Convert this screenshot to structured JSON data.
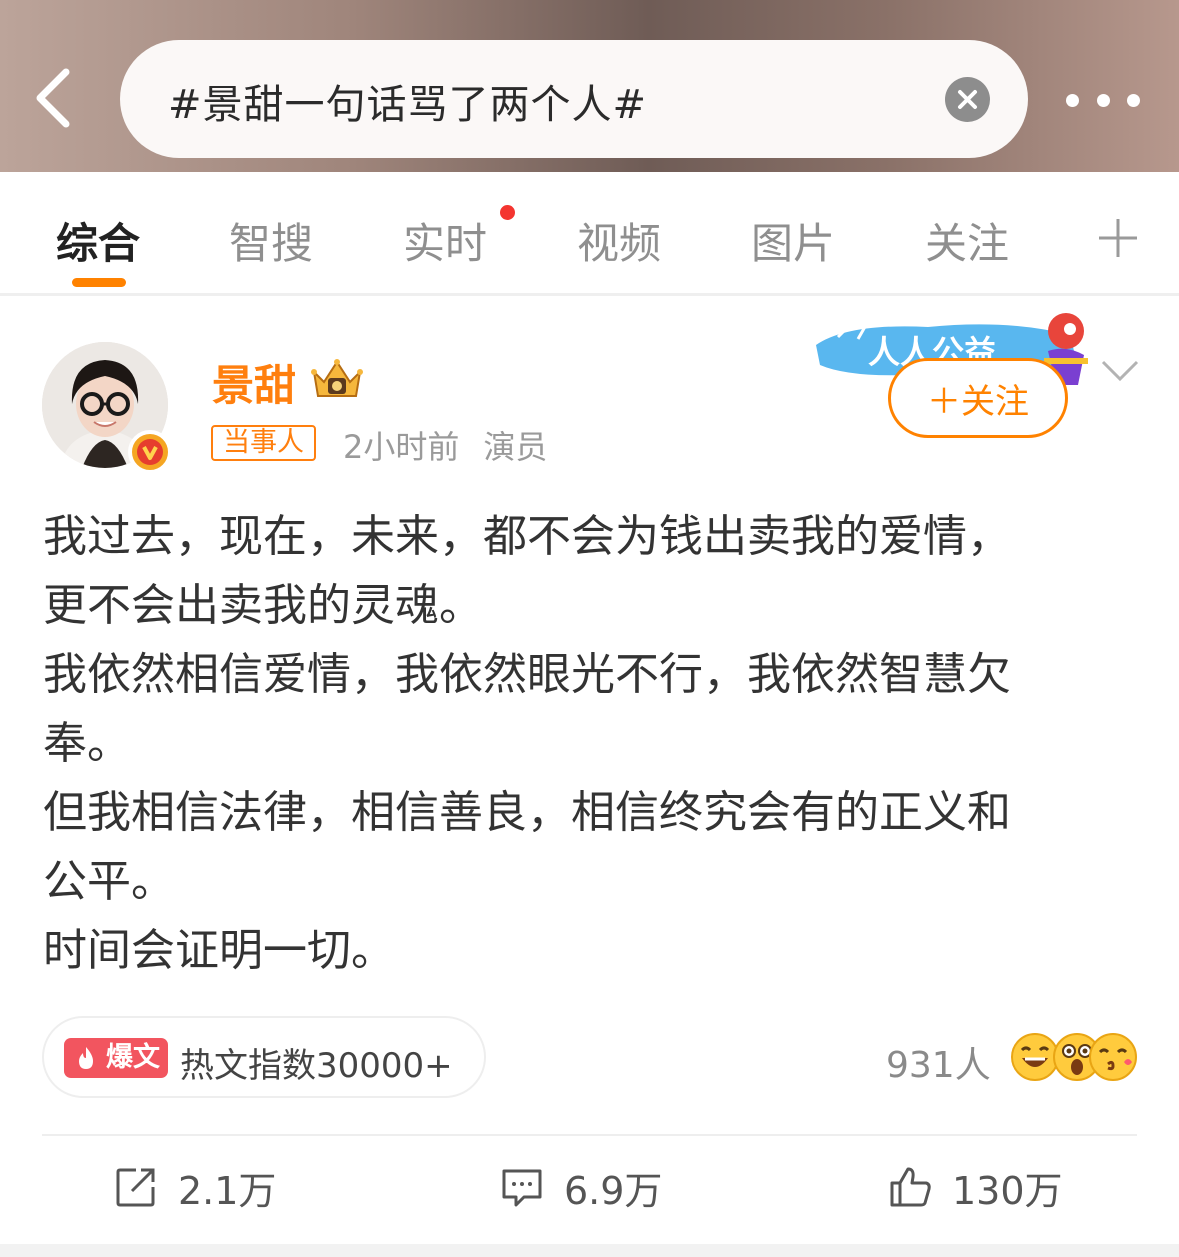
{
  "header": {
    "search_query": "#景甜一句话骂了两个人#",
    "back_icon": "chevron-left-icon",
    "clear_icon": "close-circle-icon",
    "more_icon": "more-dots-icon"
  },
  "tabs": [
    {
      "label": "综合",
      "active": true
    },
    {
      "label": "智搜"
    },
    {
      "label": "实时",
      "dot": true
    },
    {
      "label": "视频"
    },
    {
      "label": "图片"
    },
    {
      "label": "关注"
    }
  ],
  "post": {
    "username": "景甜",
    "role_tag": "当事人",
    "time": "2小时前",
    "identity": "演员",
    "banner_text": "人人公益",
    "follow_label": "＋关注",
    "body_lines": [
      "我过去，现在，未来，都不会为钱出卖我的爱情，",
      "更不会出卖我的灵魂。",
      "我依然相信爱情，我依然眼光不行，我依然智慧欠",
      "奉。",
      "但我相信法律，相信善良，相信终究会有的正义和",
      "公平。",
      "时间会证明一切。"
    ],
    "hot_tag": "爆文",
    "hot_text": "热文指数30000+",
    "reactions_count": "931人",
    "reposts": "2.1万",
    "comments": "6.9万",
    "likes": "130万"
  },
  "colors": {
    "accent": "#ff8200",
    "username": "#ff7f0e",
    "hot_tag": "#f2555f"
  }
}
